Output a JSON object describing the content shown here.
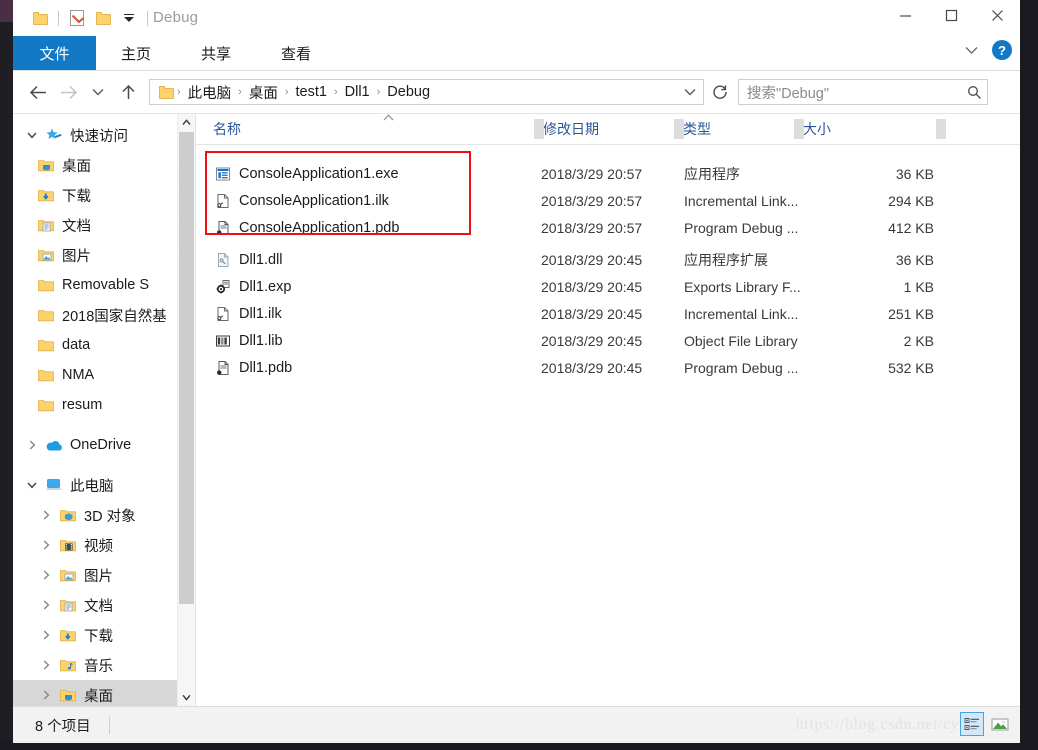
{
  "window": {
    "title": "Debug",
    "controls": {
      "minimize": "minimize-button",
      "maximize": "maximize-button",
      "close": "close-button"
    }
  },
  "quick_access_toolbar": {
    "items": [
      {
        "name": "folder-icon",
        "label": ""
      },
      {
        "name": "properties-icon",
        "label": ""
      },
      {
        "name": "new-folder-icon",
        "label": ""
      },
      {
        "name": "customize-dropdown-icon",
        "label": ""
      }
    ]
  },
  "ribbon": {
    "tabs": [
      {
        "label": "文件",
        "active": true
      },
      {
        "label": "主页",
        "active": false
      },
      {
        "label": "共享",
        "active": false
      },
      {
        "label": "查看",
        "active": false
      }
    ],
    "expand_icon": "chevron-down-icon",
    "help_label": "?"
  },
  "navigation": {
    "back": "←",
    "forward": "→",
    "recent": "⌄",
    "up": "↑",
    "refresh_icon": "refresh-icon",
    "breadcrumbs": [
      "此电脑",
      "桌面",
      "test1",
      "Dll1",
      "Debug"
    ],
    "separator": "›"
  },
  "search": {
    "placeholder": "搜索\"Debug\"",
    "icon": "search-icon"
  },
  "sidebar": {
    "groups": [
      {
        "name": "快速访问",
        "icon": "star-pin-icon",
        "expanded": true,
        "items": [
          {
            "label": "桌面",
            "icon": "desktop-folder-icon",
            "pinned": true
          },
          {
            "label": "下载",
            "icon": "downloads-folder-icon",
            "pinned": true
          },
          {
            "label": "文档",
            "icon": "documents-folder-icon",
            "pinned": true
          },
          {
            "label": "图片",
            "icon": "pictures-folder-icon",
            "pinned": true
          },
          {
            "label": "Removable S",
            "icon": "folder-icon",
            "pinned": true
          },
          {
            "label": "2018国家自然基",
            "icon": "folder-icon",
            "pinned": false
          },
          {
            "label": "data",
            "icon": "folder-icon",
            "pinned": false
          },
          {
            "label": "NMA",
            "icon": "folder-icon",
            "pinned": false
          },
          {
            "label": "resum",
            "icon": "folder-icon",
            "pinned": false
          }
        ]
      },
      {
        "name": "OneDrive",
        "icon": "onedrive-cloud-icon",
        "expanded": false,
        "items": []
      },
      {
        "name": "此电脑",
        "icon": "this-pc-icon",
        "expanded": true,
        "items": [
          {
            "label": "3D 对象",
            "icon": "3d-objects-icon",
            "pinned": false
          },
          {
            "label": "视频",
            "icon": "videos-folder-icon",
            "pinned": false
          },
          {
            "label": "图片",
            "icon": "pictures-folder-icon",
            "pinned": false
          },
          {
            "label": "文档",
            "icon": "documents-folder-icon",
            "pinned": false
          },
          {
            "label": "下载",
            "icon": "downloads-folder-icon",
            "pinned": false
          },
          {
            "label": "音乐",
            "icon": "music-folder-icon",
            "pinned": false
          },
          {
            "label": "桌面",
            "icon": "desktop-folder-icon",
            "pinned": false,
            "highlighted": true
          }
        ]
      }
    ]
  },
  "file_list": {
    "columns": [
      {
        "label": "名称",
        "sorted": true,
        "sort_direction": "asc"
      },
      {
        "label": "修改日期",
        "sorted": false
      },
      {
        "label": "类型",
        "sorted": false
      },
      {
        "label": "大小",
        "sorted": false
      }
    ],
    "rows": [
      {
        "name": "ConsoleApplication1.exe",
        "icon": "exe-file-icon",
        "date": "2018/3/29 20:57",
        "type": "应用程序",
        "size": "36 KB"
      },
      {
        "name": "ConsoleApplication1.ilk",
        "icon": "ilk-file-icon",
        "date": "2018/3/29 20:57",
        "type": "Incremental Link...",
        "size": "294 KB"
      },
      {
        "name": "ConsoleApplication1.pdb",
        "icon": "pdb-file-icon",
        "date": "2018/3/29 20:57",
        "type": "Program Debug ...",
        "size": "412 KB"
      },
      {
        "name": "Dll1.dll",
        "icon": "dll-file-icon",
        "date": "2018/3/29 20:45",
        "type": "应用程序扩展",
        "size": "36 KB"
      },
      {
        "name": "Dll1.exp",
        "icon": "exp-file-icon",
        "date": "2018/3/29 20:45",
        "type": "Exports Library F...",
        "size": "1 KB"
      },
      {
        "name": "Dll1.ilk",
        "icon": "ilk-file-icon",
        "date": "2018/3/29 20:45",
        "type": "Incremental Link...",
        "size": "251 KB"
      },
      {
        "name": "Dll1.lib",
        "icon": "lib-file-icon",
        "date": "2018/3/29 20:45",
        "type": "Object File Library",
        "size": "2 KB"
      },
      {
        "name": "Dll1.pdb",
        "icon": "pdb-file-icon",
        "date": "2018/3/29 20:45",
        "type": "Program Debug ...",
        "size": "532 KB"
      }
    ]
  },
  "annotation": {
    "color": "#ee1111",
    "covers_rows": 3
  },
  "status_bar": {
    "item_count": "8 个项目",
    "watermark": "https://blog.csdn.net/cyn",
    "views": [
      {
        "name": "details-view-button",
        "active": true
      },
      {
        "name": "large-icons-view-button",
        "active": false
      }
    ]
  }
}
